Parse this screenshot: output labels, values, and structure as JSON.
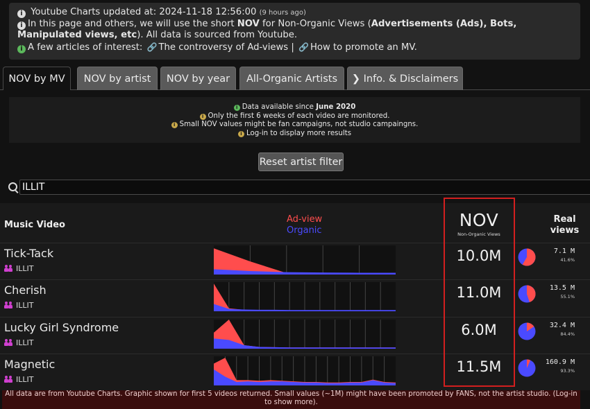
{
  "info": {
    "line1_prefix": "Youtube Charts",
    "line1_text": " updated at: 2024-11-18 12:56:00 ",
    "line1_small": "(9 hours ago)",
    "line2_a": "In this page and others, we will use the short ",
    "line2_nov": "NOV",
    "line2_b": " for Non-Organic Views (",
    "line2_strong": "Advertisements (Ads), Bots, Manipulated views, etc",
    "line2_c": "). All data is sourced from Youtube.",
    "line3_prefix": "A few articles of interest:",
    "link1": "The controversy of Ad-views",
    "separator": "|",
    "link2": "How to promote an MV."
  },
  "tabs": [
    {
      "label": "NOV by MV",
      "active": true
    },
    {
      "label": "NOV by artist"
    },
    {
      "label": "NOV by year"
    },
    {
      "label": "All-Organic Artists"
    },
    {
      "label": "Info. & Disclaimers"
    }
  ],
  "notice": {
    "line1_a": "Data available since ",
    "line1_b": "June 2020",
    "line2": "Only the first 6 weeks of each video are monitored.",
    "line3": "Small NOV values might be fan campaigns, not studio campaingns.",
    "line4": "Log-in to display more results"
  },
  "reset_label": "Reset artist filter",
  "search_value": "ILLIT",
  "table": {
    "col_mv": "Music Video",
    "col_ad": "Ad-view",
    "col_org": "Organic",
    "col_nov": "NOV",
    "col_nov_sub": "Non-Organic Views",
    "col_real": "Real views",
    "rows": [
      {
        "title": "Tick-Tack",
        "artist": "ILLIT",
        "nov": "10.0M",
        "real": "7.1 M",
        "pct": "41.6%",
        "organic_fraction": 0.416,
        "ad": [
          0.9,
          0.45,
          0.05,
          0.03,
          0.02,
          0.02
        ],
        "org": [
          0.18,
          0.12,
          0.08,
          0.07,
          0.06,
          0.06
        ]
      },
      {
        "title": "Cherish",
        "artist": "ILLIT",
        "nov": "11.0M",
        "real": "13.5 M",
        "pct": "55.1%",
        "organic_fraction": 0.551,
        "ad": [
          0.95,
          0.1,
          0.05,
          0.04,
          0.03,
          0.03,
          0.02,
          0.02,
          0.02,
          0.02,
          0.02,
          0.02,
          0.02
        ],
        "org": [
          0.25,
          0.08,
          0.06,
          0.05,
          0.05,
          0.04,
          0.04,
          0.04,
          0.04,
          0.04,
          0.04,
          0.04,
          0.04
        ]
      },
      {
        "title": "Lucky Girl Syndrome",
        "artist": "ILLIT",
        "nov": "6.0M",
        "real": "32.4 M",
        "pct": "84.4%",
        "organic_fraction": 0.844,
        "ad": [
          0.55,
          1.0,
          0.12,
          0.06,
          0.05,
          0.04,
          0.04,
          0.04,
          0.04,
          0.04,
          0.04,
          0.04,
          0.04
        ],
        "org": [
          0.35,
          0.3,
          0.12,
          0.06,
          0.05,
          0.04,
          0.04,
          0.04,
          0.04,
          0.04,
          0.04,
          0.04,
          0.04
        ]
      },
      {
        "title": "Magnetic",
        "artist": "ILLIT",
        "nov": "11.5M",
        "real": "160.9 M",
        "pct": "93.3%",
        "organic_fraction": 0.933,
        "ad": [
          0.75,
          0.95,
          0.18,
          0.18,
          0.16,
          0.18,
          0.16,
          0.14,
          0.12,
          0.12,
          0.1,
          0.1,
          0.12,
          0.12,
          0.2,
          0.12,
          0.1
        ],
        "org": [
          0.55,
          0.3,
          0.12,
          0.14,
          0.12,
          0.14,
          0.14,
          0.12,
          0.1,
          0.1,
          0.08,
          0.08,
          0.1,
          0.1,
          0.18,
          0.1,
          0.08
        ]
      }
    ]
  },
  "footer": "All data are from Youtube Charts. Graphic shown for first 5 videos returned. Small values (~1M) might have been promoted by FANS, not the artist studio. (Log-in to show more).",
  "colors": {
    "ad": "#ff4d4d",
    "organic": "#4a4aff",
    "highlight": "#d31f1f"
  }
}
